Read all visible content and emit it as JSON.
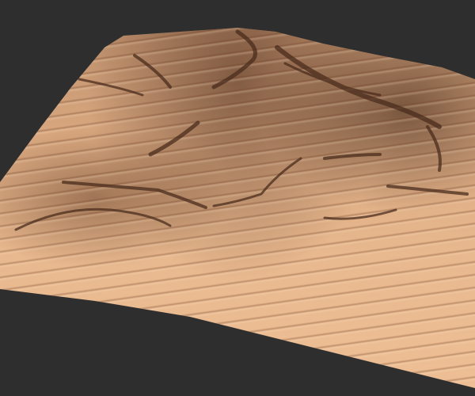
{
  "colors": {
    "background": "#2e2e2e",
    "sand_light": "#eebf95",
    "sand_mid": "#d9a880",
    "shadow": "#5a3624"
  }
}
